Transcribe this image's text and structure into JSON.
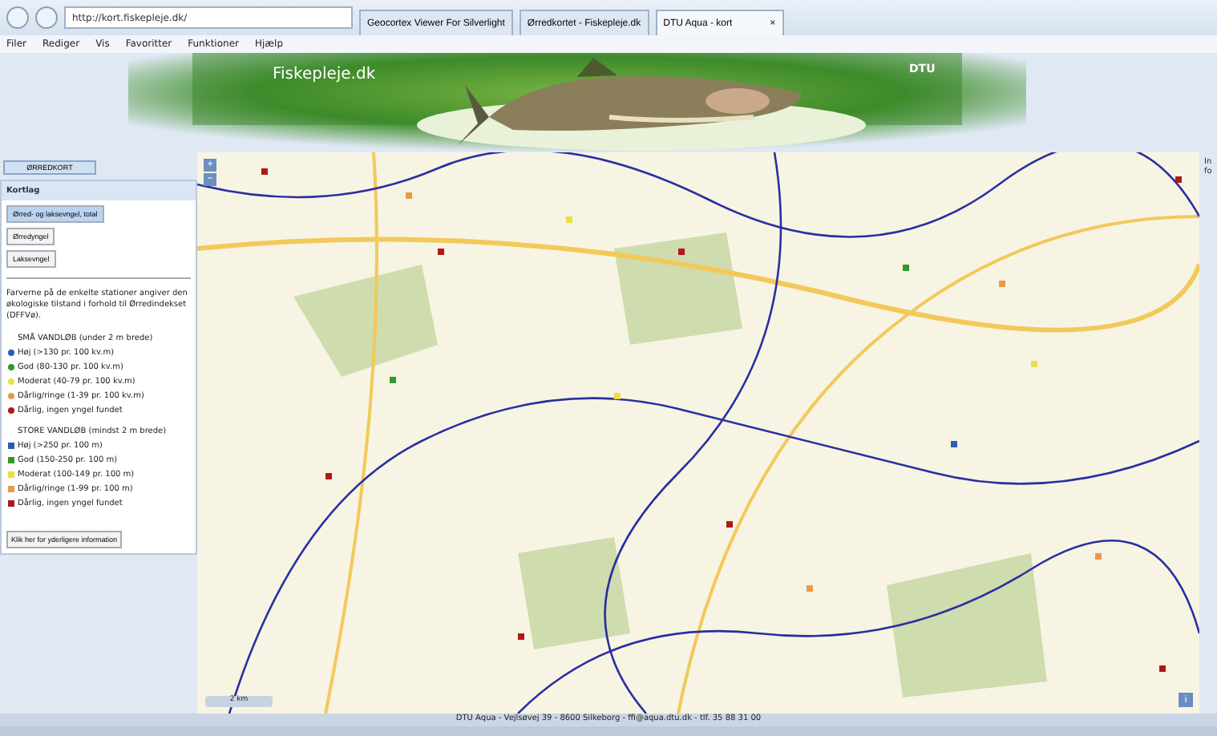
{
  "browser": {
    "address": "http://kort.fiskepleje.dk/",
    "tabs": [
      {
        "label": "Geocortex Viewer For Silverlight",
        "selected": false
      },
      {
        "label": "Ørredkortet - Fiskepleje.dk",
        "selected": false
      },
      {
        "label": "DTU Aqua - kort",
        "selected": true
      }
    ],
    "tab_close": "×",
    "menu": [
      "Filer",
      "Rediger",
      "Vis",
      "Favoritter",
      "Funktioner",
      "Hjælp"
    ]
  },
  "banner": {
    "site": "Fiskepleje.dk",
    "logo": "DTU"
  },
  "panel": {
    "top_button": "ØRREDKORT",
    "header": "Kortlag",
    "layers": [
      {
        "label": "Ørred- og laksevngel, total",
        "selected": true
      },
      {
        "label": "Ørredyngel",
        "selected": false
      },
      {
        "label": "Laksevngel",
        "selected": false
      }
    ],
    "description": "Farverne på de enkelte stationer angiver den økologiske tilstand i forhold til Ørredindekset (DFFVø).",
    "legends": [
      {
        "title": "SMÅ VANDLØB (under 2 m brede)",
        "kind": "dot",
        "items": [
          {
            "label": "Høj (>130 pr. 100 kv.m)",
            "color": "#2a5cb8"
          },
          {
            "label": "God (80-130 pr. 100 kv.m)",
            "color": "#2e9a2e"
          },
          {
            "label": "Moderat (40-79 pr. 100 kv.m)",
            "color": "#e8e04a"
          },
          {
            "label": "Dårlig/ringe (1-39 pr. 100 kv.m)",
            "color": "#e89a4a"
          },
          {
            "label": "Dårlig, ingen yngel fundet",
            "color": "#b01818"
          }
        ]
      },
      {
        "title": "STORE VANDLØB (mindst 2 m brede)",
        "kind": "square",
        "items": [
          {
            "label": "Høj (>250 pr. 100 m)",
            "color": "#2a5cb8"
          },
          {
            "label": "God (150-250 pr. 100 m)",
            "color": "#2e9a2e"
          },
          {
            "label": "Moderat (100-149 pr. 100 m)",
            "color": "#e8e04a"
          },
          {
            "label": "Dårlig/ringe (1-99 pr. 100 m)",
            "color": "#e89a4a"
          },
          {
            "label": "Dårlig, ingen yngel fundet",
            "color": "#b01818"
          }
        ]
      }
    ],
    "info_button": "Klik her for yderligere information"
  },
  "map": {
    "zoom_in": "+",
    "zoom_out": "−",
    "scale": "2 km",
    "info": "i",
    "side_tab": "Info"
  },
  "footer": "DTU Aqua - Vejlsøvej 39 - 8600 Silkeborg - ffi@aqua.dtu.dk - tlf. 35 88 31 00"
}
